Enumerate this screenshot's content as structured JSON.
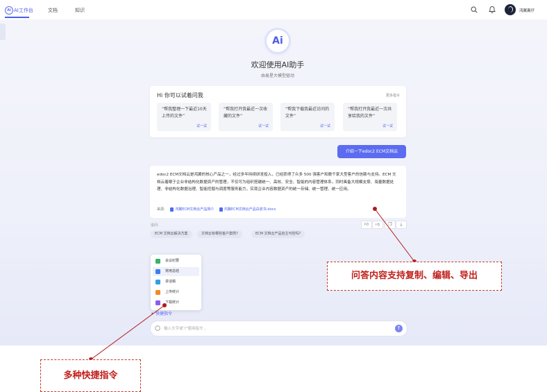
{
  "topbar": {
    "logo_text": "Ai",
    "nav": [
      "AI工作台",
      "文档",
      "知识"
    ],
    "user_name": "鸿翼离仔"
  },
  "hero": {
    "badge": "Ai",
    "title": "欢迎使用AI助手",
    "subtitle": "由易星大模型驱动"
  },
  "suggestions": {
    "title": "Hi 你可以试着问我",
    "more": "更多指令",
    "try_label": "试一试",
    "items": [
      "“帮我整理一下最近10天上传的文件”",
      "“帮我打开我最近一次收藏的文件”",
      "“帮我下载我最近访问的文件”",
      "“帮我打开我最近一次共享给我的文件”"
    ]
  },
  "user_message": "介绍一下edoc2 ECM文档云",
  "answer": {
    "text": "edoc2 ECM文档云是鸿翼的核心产品之一，经过多年持续研发投入，已经获得了众多 500 强客户和数千家大型客户的信赖与支持。ECM 文档云着眼于企业非结构化数据资产的管理，不仅可为组织搭建统一、高效、安全、智能的内容管理体系，同时具备大规模支撑、海量数据处理、非结构化数据治理、智能挖掘与调度等服务能力，实现企业内容数据资产的统一存储、统一管理、统一应用。",
    "source_label": "来源:",
    "sources": [
      "鸿翼ECM文档云产品简介",
      "鸿翼ECM文档云产品白皮书.docx"
    ]
  },
  "actions": [
    "like",
    "dislike",
    "copy",
    "export"
  ],
  "followup": {
    "label": "追问:",
    "chips": [
      "ECM 文档云解决方案",
      "文档云有哪些客户案例?",
      "ECM 文档云产品自主可控吗?"
    ]
  },
  "quick_menu": {
    "items": [
      {
        "label": "会议纪要",
        "color": "#35b36a"
      },
      {
        "label": "常用总结",
        "color": "#3b7df0"
      },
      {
        "label": "讲话稿",
        "color": "#2f9ee8"
      },
      {
        "label": "上传统计",
        "color": "#f08a24"
      },
      {
        "label": "下载统计",
        "color": "#8a5cf0"
      }
    ],
    "trigger": "快捷指令"
  },
  "input": {
    "placeholder": "输入文字或\"/\"使用指令..."
  },
  "callouts": {
    "copy_edit_export": "问答内容支持复制、编辑、导出",
    "quick_commands": "多种快捷指令"
  },
  "colors": {
    "accent": "#5b6cf0",
    "callout": "#c0201b"
  }
}
